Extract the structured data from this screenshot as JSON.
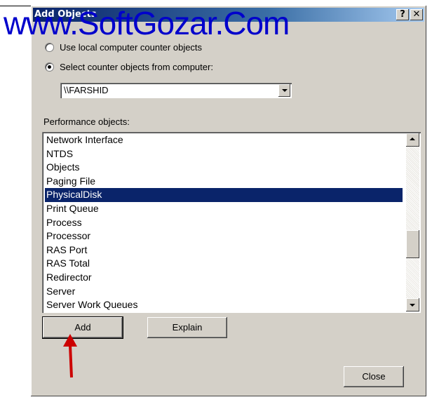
{
  "window": {
    "title": "Add Objects",
    "help_button": "?",
    "close_button": "✕"
  },
  "watermark": "www.SoftGozar.Com",
  "radio_local": "Use local computer counter objects",
  "radio_select": "Select counter objects from computer:",
  "computer": {
    "value": "\\\\FARSHID"
  },
  "perf_label": "Performance objects:",
  "objects": [
    "Network Interface",
    "NTDS",
    "Objects",
    "Paging File",
    "PhysicalDisk",
    "Print Queue",
    "Process",
    "Processor",
    "RAS Port",
    "RAS Total",
    "Redirector",
    "Server",
    "Server Work Queues"
  ],
  "selected_object": "PhysicalDisk",
  "buttons": {
    "add": "Add",
    "explain": "Explain",
    "close": "Close"
  },
  "colors": {
    "selection": "#0a246a",
    "annotation_arrow": "#cc0000",
    "watermark": "#0000cc"
  }
}
